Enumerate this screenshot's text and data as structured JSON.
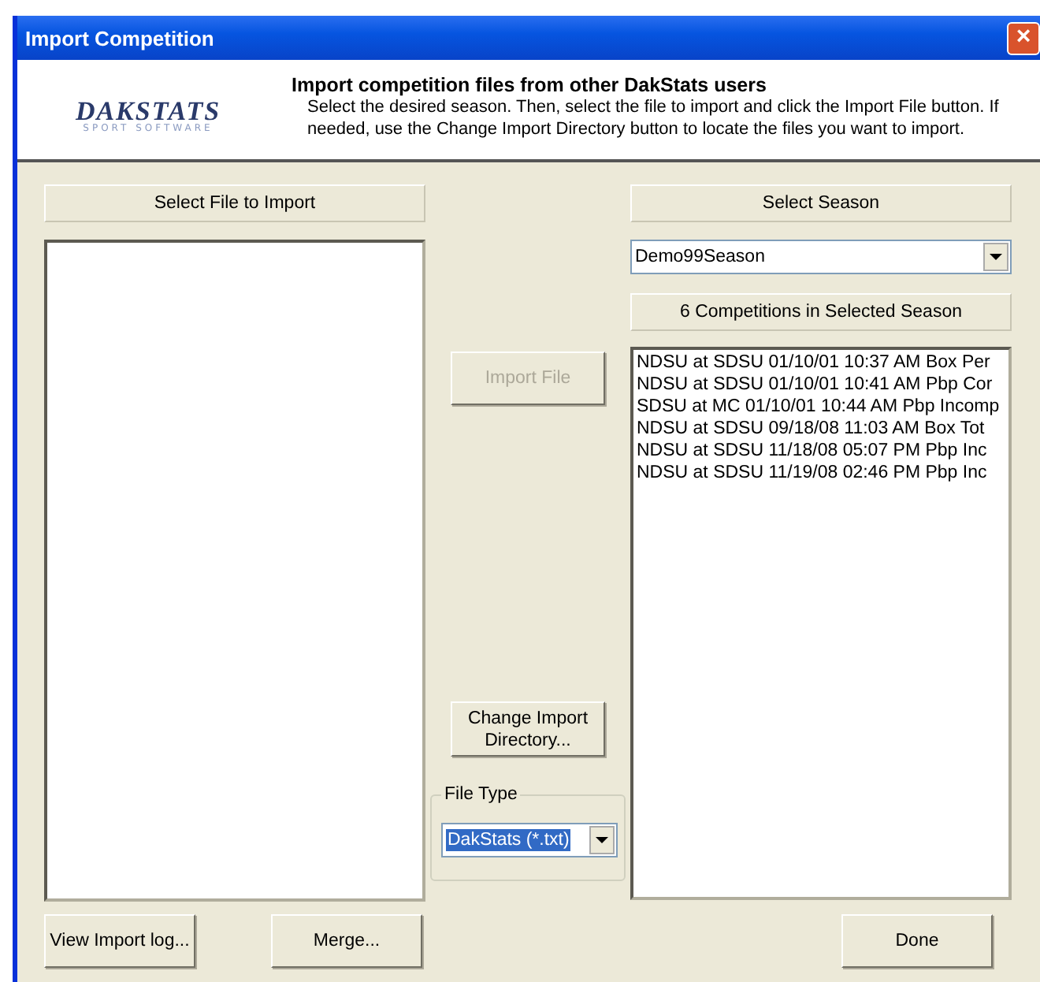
{
  "window": {
    "title": "Import Competition",
    "close": "×"
  },
  "header": {
    "logo": "DAKSTATS",
    "logo_tagline": "SPORT SOFTWARE",
    "heading": "Import competition files from other DakStats users",
    "description": "Select the desired season. Then, select the file to import and click the Import File button. If needed, use the Change Import Directory button to locate the files you want to import."
  },
  "file_panel": {
    "label": "Select File to Import"
  },
  "middle": {
    "import_button": {
      "label": "Import File",
      "disabled": true
    },
    "change_dir_button": {
      "label": "Change Import Directory...",
      "disabled": false
    },
    "file_type": {
      "legend": "File Type",
      "value": "DakStats (*.txt)"
    }
  },
  "season_panel": {
    "label": "Select Season",
    "season_value": "Demo99Season",
    "count_label": "6 Competitions in Selected Season",
    "competitions": [
      {
        "text": "NDSU at SDSU 01/10/01 10:37 AM  Box Per"
      },
      {
        "text": "NDSU at SDSU 01/10/01 10:41 AM  Pbp Cor"
      },
      {
        "text": "SDSU at MC 01/10/01 10:44 AM  Pbp Incomp"
      },
      {
        "text": "NDSU at SDSU 09/18/08 11:03 AM  Box Tot"
      },
      {
        "text": "NDSU at SDSU 11/18/08 05:07 PM  Pbp Inc"
      },
      {
        "text": "NDSU at SDSU 11/19/08 02:46 PM  Pbp Inc"
      }
    ]
  },
  "buttons": [
    {
      "label": "View Import log..."
    },
    {
      "label": "Merge..."
    },
    {
      "label": "Done"
    }
  ]
}
